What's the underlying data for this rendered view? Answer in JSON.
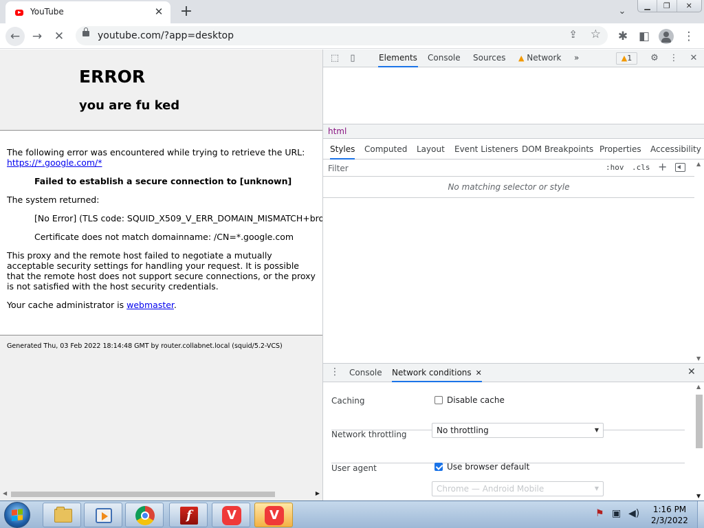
{
  "browser": {
    "tab": {
      "title": "YouTube",
      "close": "✕"
    },
    "new_tab": "+",
    "tab_search": "⌄",
    "window_controls": {
      "minimize": "▁",
      "restore": "❐",
      "close": "✕"
    },
    "toolbar": {
      "back": "←",
      "forward": "→",
      "stop": "✕",
      "extensions": "✱",
      "sidepanel": "◧",
      "menu": "⋮"
    },
    "url": "youtube.com/?app=desktop",
    "share": "⇪",
    "star": "☆"
  },
  "page": {
    "error_title": "ERROR",
    "error_subtitle": "you are fu ked",
    "line1": "The following error was encountered while trying to retrieve the URL:",
    "url_link": "https://*.google.com/*",
    "failed": "Failed to establish a secure connection to [unknown]",
    "system_returned": "The system returned:",
    "tls_error": "[No Error] (TLS code: SQUID_X509_V_ERR_DOMAIN_MISMATCH+bro",
    "cert_mismatch": "Certificate does not match domainname: /CN=*.google.com",
    "proxy_text": "This proxy and the remote host failed to negotiate a mutually acceptable security settings for handling your request. It is possible that the remote host does not support secure connections, or the proxy is not satisfied with the host security credentials.",
    "cache_admin": "Your cache administrator is",
    "webmaster": "webmaster",
    "period": ".",
    "footer": "Generated Thu, 03 Feb 2022 18:14:48 GMT by router.collabnet.local (squid/5.2-VCS)"
  },
  "devtools": {
    "tabs": [
      "Elements",
      "Console",
      "Sources",
      "Network"
    ],
    "more_tabs": "»",
    "issues_count": "1",
    "breadcrumb": "html",
    "subtabs": [
      "Styles",
      "Computed",
      "Layout",
      "Event Listeners",
      "DOM Breakpoints",
      "Properties",
      "Accessibility"
    ],
    "filter_placeholder": "Filter",
    "hov": ":hov",
    "cls": ".cls",
    "add_rule": "+",
    "no_match": "No matching selector or style",
    "drawer": {
      "tabs": [
        "Console",
        "Network conditions"
      ],
      "close_tab": "✕",
      "caching_label": "Caching",
      "disable_cache": "Disable cache",
      "disable_cache_checked": false,
      "throttling_label": "Network throttling",
      "throttling_value": "No throttling",
      "user_agent_label": "User agent",
      "use_default": "Use browser default",
      "use_default_checked": true,
      "ua_value": "Chrome — Android Mobile"
    }
  },
  "taskbar": {
    "clock_time": "1:16 PM",
    "clock_date": "2/3/2022",
    "vivaldi_letter": "V",
    "flash_letter": "f"
  },
  "colors": {
    "accent": "#1a73e8",
    "link": "#0000ee",
    "warning": "#f29900"
  }
}
